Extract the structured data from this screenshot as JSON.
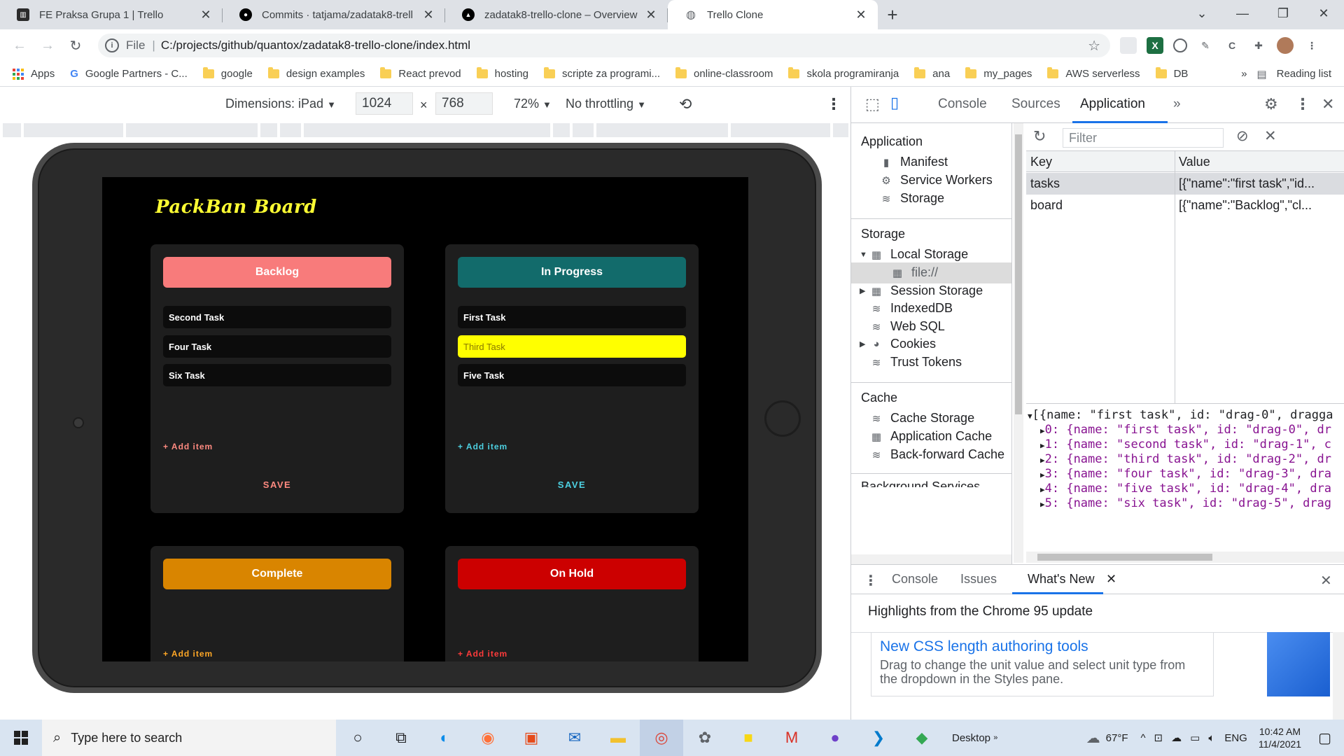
{
  "browser": {
    "tabs": [
      {
        "title": "FE Praksa Grupa 1 | Trello",
        "icon": "trello-icon"
      },
      {
        "title": "Commits · tatjama/zadatak8-trell",
        "icon": "github-icon"
      },
      {
        "title": "zadatak8-trello-clone – Overview",
        "icon": "vercel-icon"
      },
      {
        "title": "Trello Clone",
        "icon": "globe-icon",
        "active": true
      }
    ],
    "address": {
      "scheme": "File",
      "separator": "|",
      "url": "C:/projects/github/quantox/zadatak8-trello-clone/index.html"
    },
    "bookmarks": [
      "Apps",
      "Google Partners - C...",
      "google",
      "design examples",
      "React prevod",
      "hosting",
      "scripte za programi...",
      "online-classroom",
      "skola programiranja",
      "ana",
      "my_pages",
      "AWS serverless",
      "DB"
    ],
    "overflow": "»",
    "reading_list": "Reading list"
  },
  "device_toolbar": {
    "dimensions_label": "Dimensions: iPad",
    "width": "1024",
    "times": "×",
    "height": "768",
    "zoom": "72%",
    "throttling": "No throttling"
  },
  "app": {
    "brand": "PackBan Board",
    "columns": [
      {
        "title": "Backlog",
        "color": "#f87b7b",
        "accent": "#ff8a80",
        "tasks": [
          "Second Task",
          "Four Task",
          "Six Task"
        ],
        "add": "+ Add item",
        "save": "SAVE"
      },
      {
        "title": "In Progress",
        "color": "#126b6b",
        "accent": "#4dd0e1",
        "tasks": [
          "First Task",
          "Third Task",
          "Five Task"
        ],
        "highlighted_task": 1,
        "add": "+ Add item",
        "save": "SAVE"
      },
      {
        "title": "Complete",
        "color": "#d98500",
        "accent": "#ffa726",
        "tasks": [],
        "add": "+ Add item"
      },
      {
        "title": "On Hold",
        "color": "#cc0000",
        "accent": "#ff3b3b",
        "tasks": [],
        "add": "+ Add item"
      }
    ]
  },
  "devtools": {
    "tabs": [
      "Console",
      "Sources",
      "Application"
    ],
    "active_tab": "Application",
    "more": "»",
    "sidebar": {
      "application_section": "Application",
      "application_items": [
        "Manifest",
        "Service Workers",
        "Storage"
      ],
      "storage_section": "Storage",
      "storage_items": [
        "Local Storage",
        "file://",
        "Session Storage",
        "IndexedDB",
        "Web SQL",
        "Cookies",
        "Trust Tokens"
      ],
      "cache_section": "Cache",
      "cache_items": [
        "Cache Storage",
        "Application Cache",
        "Back-forward Cache"
      ],
      "partial_section": "Background Services"
    },
    "storage_view": {
      "filter_placeholder": "Filter",
      "key_header": "Key",
      "value_header": "Value",
      "rows": [
        {
          "key": "tasks",
          "value": "[{\"name\":\"first task\",\"id..."
        },
        {
          "key": "board",
          "value": "[{\"name\":\"Backlog\",\"cl..."
        }
      ],
      "preview": [
        "[{name: \"first task\", id: \"drag-0\", dragga",
        "0: {name: \"first task\", id: \"drag-0\", dr",
        "1: {name: \"second task\", id: \"drag-1\", c",
        "2: {name: \"third task\", id: \"drag-2\", dr",
        "3: {name: \"four task\", id: \"drag-3\", dra",
        "4: {name: \"five task\", id: \"drag-4\", dra",
        "5: {name: \"six task\", id: \"drag-5\", drag"
      ]
    },
    "drawer": {
      "tabs": [
        "Console",
        "Issues",
        "What's New"
      ],
      "active_tab": "What's New",
      "highlights": "Highlights from the Chrome 95 update",
      "card_title": "New CSS length authoring tools",
      "card_desc": "Drag to change the unit value and select unit type from the dropdown in the Styles pane."
    }
  },
  "taskbar": {
    "search_placeholder": "Type here to search",
    "desktop_label": "Desktop",
    "weather": "67°F",
    "language": "ENG",
    "time": "10:42 AM",
    "date": "11/4/2021"
  }
}
